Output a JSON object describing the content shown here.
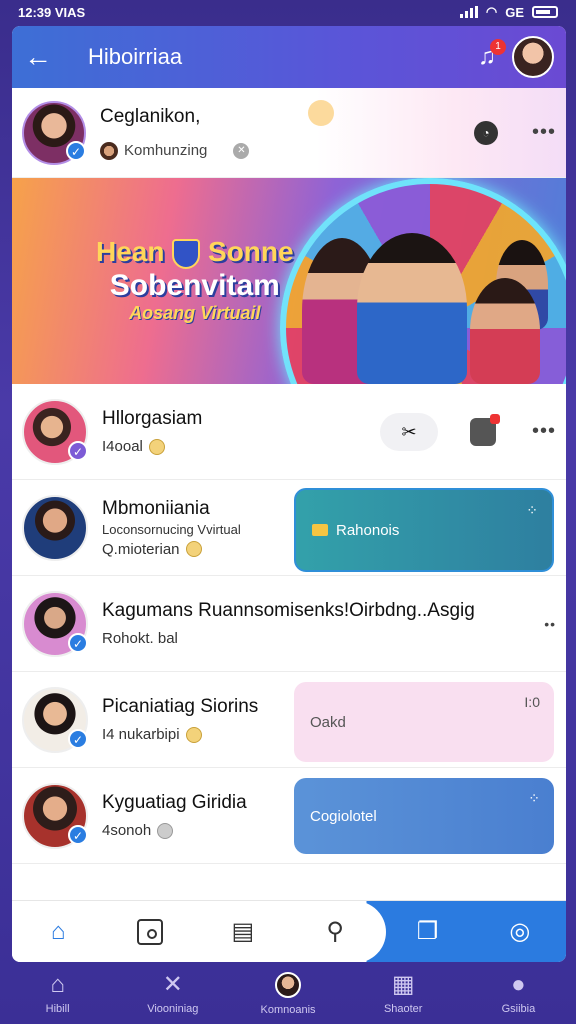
{
  "status": {
    "time": "12:39 VIAS",
    "network": "GE"
  },
  "appbar": {
    "title": "Hiboirriaa",
    "badge_count": "1"
  },
  "profile": {
    "name": "Ceglanikon,",
    "subtitle": "Komhunzing"
  },
  "banner": {
    "line1": "Hean",
    "line1b": "Sonne",
    "line2": "Sobenvitam",
    "line3": "Aosang Virtuail"
  },
  "rows": [
    {
      "name": "Hllorgasiam",
      "meta": "I4ooal",
      "action": "✂"
    },
    {
      "name": "Mbmoniiania",
      "meta2": "Loconsornucing Vvirtual",
      "meta": "Q.mioterian",
      "panel_label": "Rahonois"
    },
    {
      "name": "Kagumans Ruannsomisenks!Oirbdng..Asgig",
      "meta": "Rohokt. bal"
    },
    {
      "name": "Picaniatiag Siorins",
      "meta": "I4 nukarbipi",
      "panel_label": "Oakd",
      "panel_corner": "I:0"
    },
    {
      "name": "Kyguatiag Giridia",
      "meta": "4sonoh",
      "panel_label": "Cogiolotel"
    }
  ],
  "sysnav": [
    {
      "icon": "home-icon",
      "label": "Hibill"
    },
    {
      "icon": "tools-icon",
      "label": "Viooniniag"
    },
    {
      "icon": "avatar",
      "label": "Komnoanis"
    },
    {
      "icon": "chart-icon",
      "label": "Shaoter"
    },
    {
      "icon": "person-icon",
      "label": "Gsiibia"
    }
  ]
}
